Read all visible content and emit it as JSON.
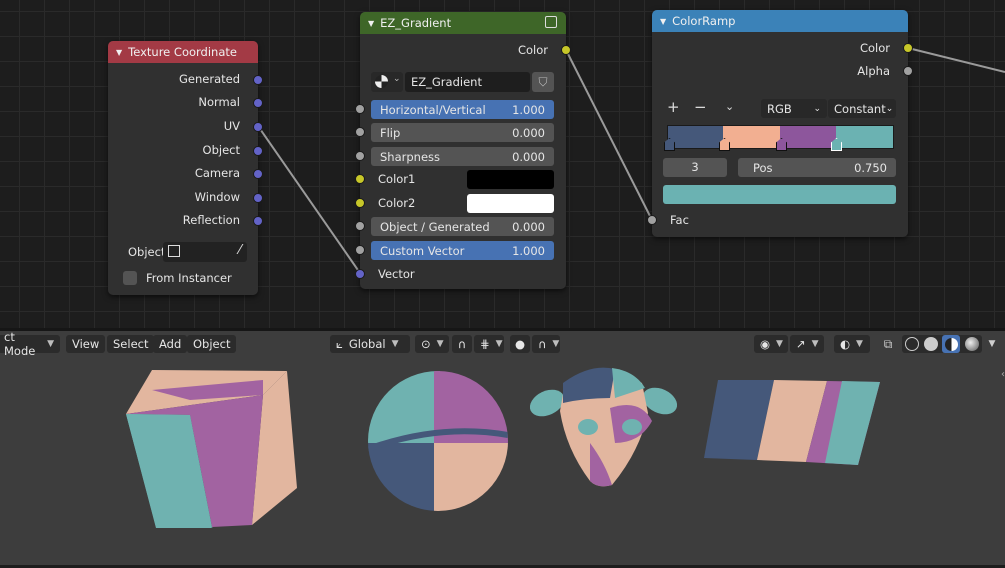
{
  "node_editor": {
    "texture_coordinate": {
      "title": "Texture Coordinate",
      "outputs": [
        "Generated",
        "Normal",
        "UV",
        "Object",
        "Camera",
        "Window",
        "Reflection"
      ],
      "object_label": "Object",
      "from_instancer_label": "From Instancer",
      "from_instancer_checked": false,
      "header_color": "#a33a45"
    },
    "ez_gradient": {
      "title": "EZ_Gradient",
      "output_label": "Color",
      "group_name": "EZ_Gradient",
      "inputs": [
        {
          "label": "Horizontal/Vertical",
          "value": "1.000",
          "highlight": true
        },
        {
          "label": "Flip",
          "value": "0.000",
          "highlight": false
        },
        {
          "label": "Sharpness",
          "value": "0.000",
          "highlight": false
        }
      ],
      "color1_label": "Color1",
      "color1": "#000000",
      "color2_label": "Color2",
      "color2": "#ffffff",
      "inputs2": [
        {
          "label": "Object / Generated",
          "value": "0.000",
          "highlight": false
        },
        {
          "label": "Custom Vector",
          "value": "1.000",
          "highlight": true
        }
      ],
      "vector_label": "Vector",
      "header_color": "#3e6628"
    },
    "color_ramp": {
      "title": "ColorRamp",
      "outputs": [
        "Color",
        "Alpha"
      ],
      "add_label": "+",
      "remove_label": "−",
      "color_mode": "RGB",
      "interpolation": "Constant",
      "stop_index": "3",
      "pos_label": "Pos",
      "pos_value": "0.750",
      "selected_color": "#6bb2b2",
      "ramp_colors": [
        "#45587a",
        "#f2af91",
        "#8d569c",
        "#6bb2b2"
      ],
      "fac_label": "Fac",
      "header_color": "#3b82b8"
    }
  },
  "viewport": {
    "mode": "ct Mode",
    "menus": [
      "View",
      "Select",
      "Add",
      "Object"
    ],
    "transform_orientation": "Global",
    "object_colors": {
      "navy": "#45587a",
      "peach": "#e2b69f",
      "purple": "#a263a1",
      "teal": "#6fb2b0"
    }
  }
}
